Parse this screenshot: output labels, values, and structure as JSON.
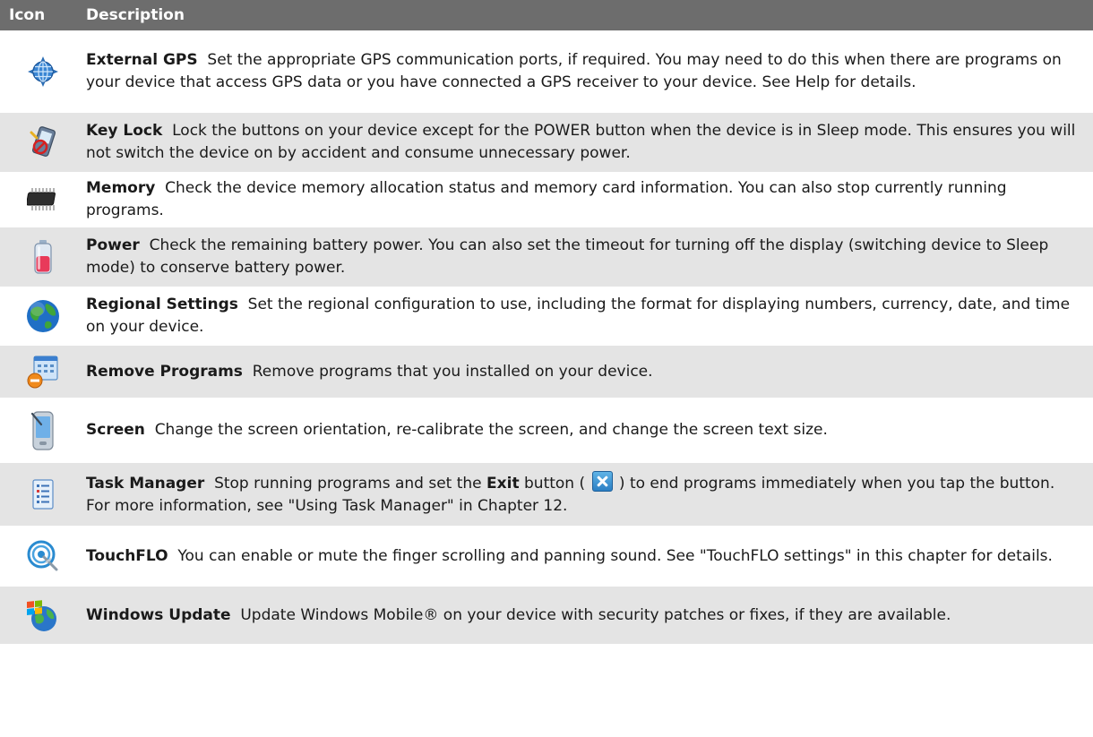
{
  "header": {
    "icon_col": "Icon",
    "desc_col": "Description"
  },
  "rows": [
    {
      "title": "External GPS",
      "text": "Set the appropriate GPS communication ports, if required. You may need to do this when there are programs on your device that access GPS data or you have connected a GPS receiver to your device. See Help for details.",
      "icon": "globe-crosshair-icon"
    },
    {
      "title": "Key Lock",
      "text": "Lock the buttons on your device except for the POWER button when the device is in Sleep mode. This ensures you will not switch the device on by accident and consume unnecessary power.",
      "icon": "key-lock-icon"
    },
    {
      "title": "Memory",
      "text": "Check the device memory allocation status and memory card information. You can also stop currently running programs.",
      "icon": "memory-chip-icon"
    },
    {
      "title": "Power",
      "text": "Check the remaining battery power. You can also set the timeout for turning off the display (switching device to Sleep mode) to conserve battery power.",
      "icon": "battery-icon"
    },
    {
      "title": "Regional Settings",
      "text": "Set the regional configuration to use, including the format for displaying numbers, currency, date, and time on your device.",
      "icon": "earth-globe-icon"
    },
    {
      "title": "Remove Programs",
      "text": "Remove programs that you installed on your device.",
      "icon": "remove-programs-icon"
    },
    {
      "title": "Screen",
      "text": "Change the screen orientation, re-calibrate the screen, and change the screen text size.",
      "icon": "screen-device-icon"
    },
    {
      "title": "Task Manager",
      "text_before": "Stop running programs and set the",
      "bold_word": "Exit",
      "text_middle": "button (",
      "text_after": ") to end programs immediately when you tap the button. For more information, see \"Using Task Manager\" in Chapter 12.",
      "icon": "task-manager-icon",
      "inline_icon": "exit-x-icon"
    },
    {
      "title": "TouchFLO",
      "text": "You can enable or mute the finger scrolling and panning sound. See \"TouchFLO settings\" in this chapter for details.",
      "icon": "touchflo-icon"
    },
    {
      "title": "Windows Update",
      "text": "Update Windows Mobile® on your device with security patches or fixes, if they are available.",
      "icon": "windows-update-icon"
    }
  ]
}
